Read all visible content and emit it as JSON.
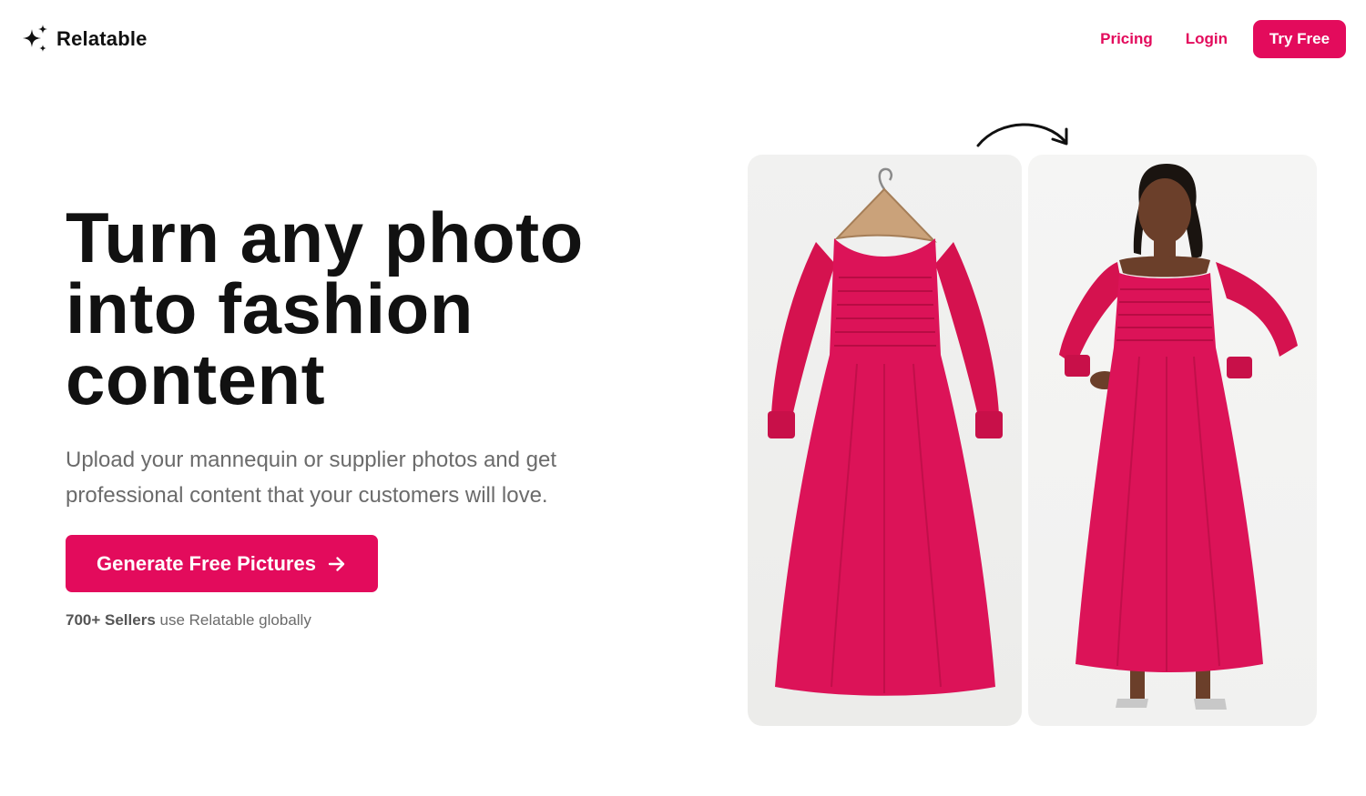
{
  "header": {
    "brand_name": "Relatable",
    "nav": {
      "pricing": "Pricing",
      "login": "Login",
      "try_free": "Try Free"
    }
  },
  "hero": {
    "headline_line1": "Turn any photo",
    "headline_line2": "into fashion",
    "headline_line3": "content",
    "subtitle": "Upload your mannequin or supplier photos and get professional content that your customers will love.",
    "cta_label": "Generate Free Pictures",
    "social_proof_strong": "700+ Sellers",
    "social_proof_rest": " use Relatable globally"
  },
  "showcase": {
    "before_image": "red-dress-on-hanger",
    "after_image": "model-wearing-red-dress",
    "transition_icon": "curved-arrow-icon"
  },
  "colors": {
    "accent": "#e30b5c",
    "dress": "#dc1358",
    "text_dark": "#111111",
    "text_muted": "#6b6b6b",
    "panel_bg": "#f1f1f0"
  }
}
